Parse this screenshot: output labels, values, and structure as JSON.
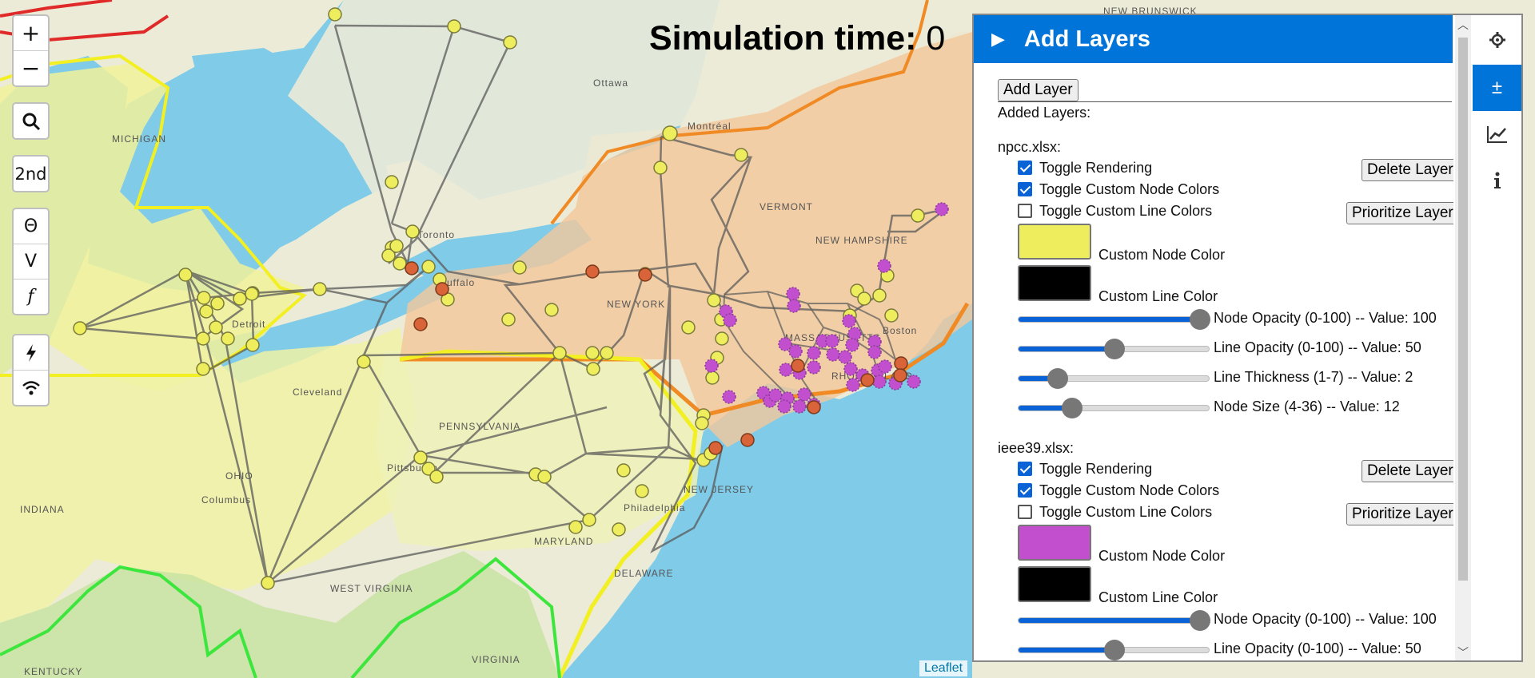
{
  "zoom_controls": {
    "zoom_in": "+",
    "zoom_out": "−"
  },
  "map_controls": {
    "search_label": "",
    "second_label": "2nd",
    "theta_label": "Θ",
    "voltage_label": "V",
    "f_label": "f"
  },
  "simulation": {
    "label": "Simulation time:",
    "value": "0"
  },
  "panel": {
    "header_title": "Add Layers",
    "add_layer_button": "Add Layer",
    "added_layers_label": "Added Layers:",
    "layers": [
      {
        "file": "npcc.xlsx:",
        "toggle_rendering": "Toggle Rendering",
        "toggle_node_colors": "Toggle Custom Node Colors",
        "toggle_line_colors": "Toggle Custom Line Colors",
        "delete_button": "Delete Layer",
        "prioritize_button": "Prioritize Layer",
        "rendering_checked": true,
        "node_colors_checked": true,
        "line_colors_checked": false,
        "node_color_label": "Custom Node Color",
        "node_color": "#eded5e",
        "line_color_label": "Custom Line Color",
        "line_color": "#000000",
        "node_opacity_label": "Node Opacity (0-100) -- Value: 100",
        "node_opacity": 100,
        "line_opacity_label": "Line Opacity (0-100) -- Value: 50",
        "line_opacity": 50,
        "line_thickness_label": "Line Thickness (1-7) -- Value: 2",
        "line_thickness": 2,
        "node_size_label": "Node Size (4-36) -- Value: 12",
        "node_size": 12
      },
      {
        "file": "ieee39.xlsx:",
        "toggle_rendering": "Toggle Rendering",
        "toggle_node_colors": "Toggle Custom Node Colors",
        "toggle_line_colors": "Toggle Custom Line Colors",
        "delete_button": "Delete Layer",
        "prioritize_button": "Prioritize Layer",
        "rendering_checked": true,
        "node_colors_checked": true,
        "line_colors_checked": false,
        "node_color_label": "Custom Node Color",
        "node_color": "#c24fce",
        "line_color_label": "Custom Line Color",
        "line_color": "#000000",
        "node_opacity_label": "Node Opacity (0-100) -- Value: 100",
        "node_opacity": 100,
        "line_opacity_label": "Line Opacity (0-100) -- Value: 50",
        "line_opacity": 50
      }
    ]
  },
  "sidebar_icons": [
    "gear-icon",
    "plus-minus-icon",
    "chart-icon",
    "info-icon"
  ],
  "sidebar_plusminus": "±",
  "map_labels": {
    "michigan": "MICHIGAN",
    "ohio": "OHIO",
    "indiana": "INDIANA",
    "pennsylvania": "PENNSYLVANIA",
    "new_york": "NEW YORK",
    "vermont": "VERMONT",
    "new_hampshire": "NEW HAMPSHIRE",
    "massachusetts": "MASSACHUSETTS",
    "rhode_island": "RHODE ISLAND",
    "new_jersey": "NEW JERSEY",
    "maryland": "MARYLAND",
    "delaware": "DELAWARE",
    "west_virginia": "WEST VIRGINIA",
    "virginia": "VIRGINIA",
    "kentucky": "KENTUCKY",
    "new_brunswick": "NEW BRUNSWICK",
    "toronto": "Toronto",
    "ottawa": "Ottawa",
    "montreal": "Montréal",
    "pittsburgh": "Pittsburgh",
    "philadelphia": "Philadelphia",
    "boston": "Boston",
    "cleveland": "Cleveland",
    "columbus": "Columbus",
    "detroit": "Detroit",
    "buffalo": "Buffalo"
  },
  "colors": {
    "accent": "#0074d9",
    "npcc_node": "#eded5e",
    "ieee_node": "#c24fce",
    "generator": "#d9643a"
  },
  "attribution": "Leaflet"
}
